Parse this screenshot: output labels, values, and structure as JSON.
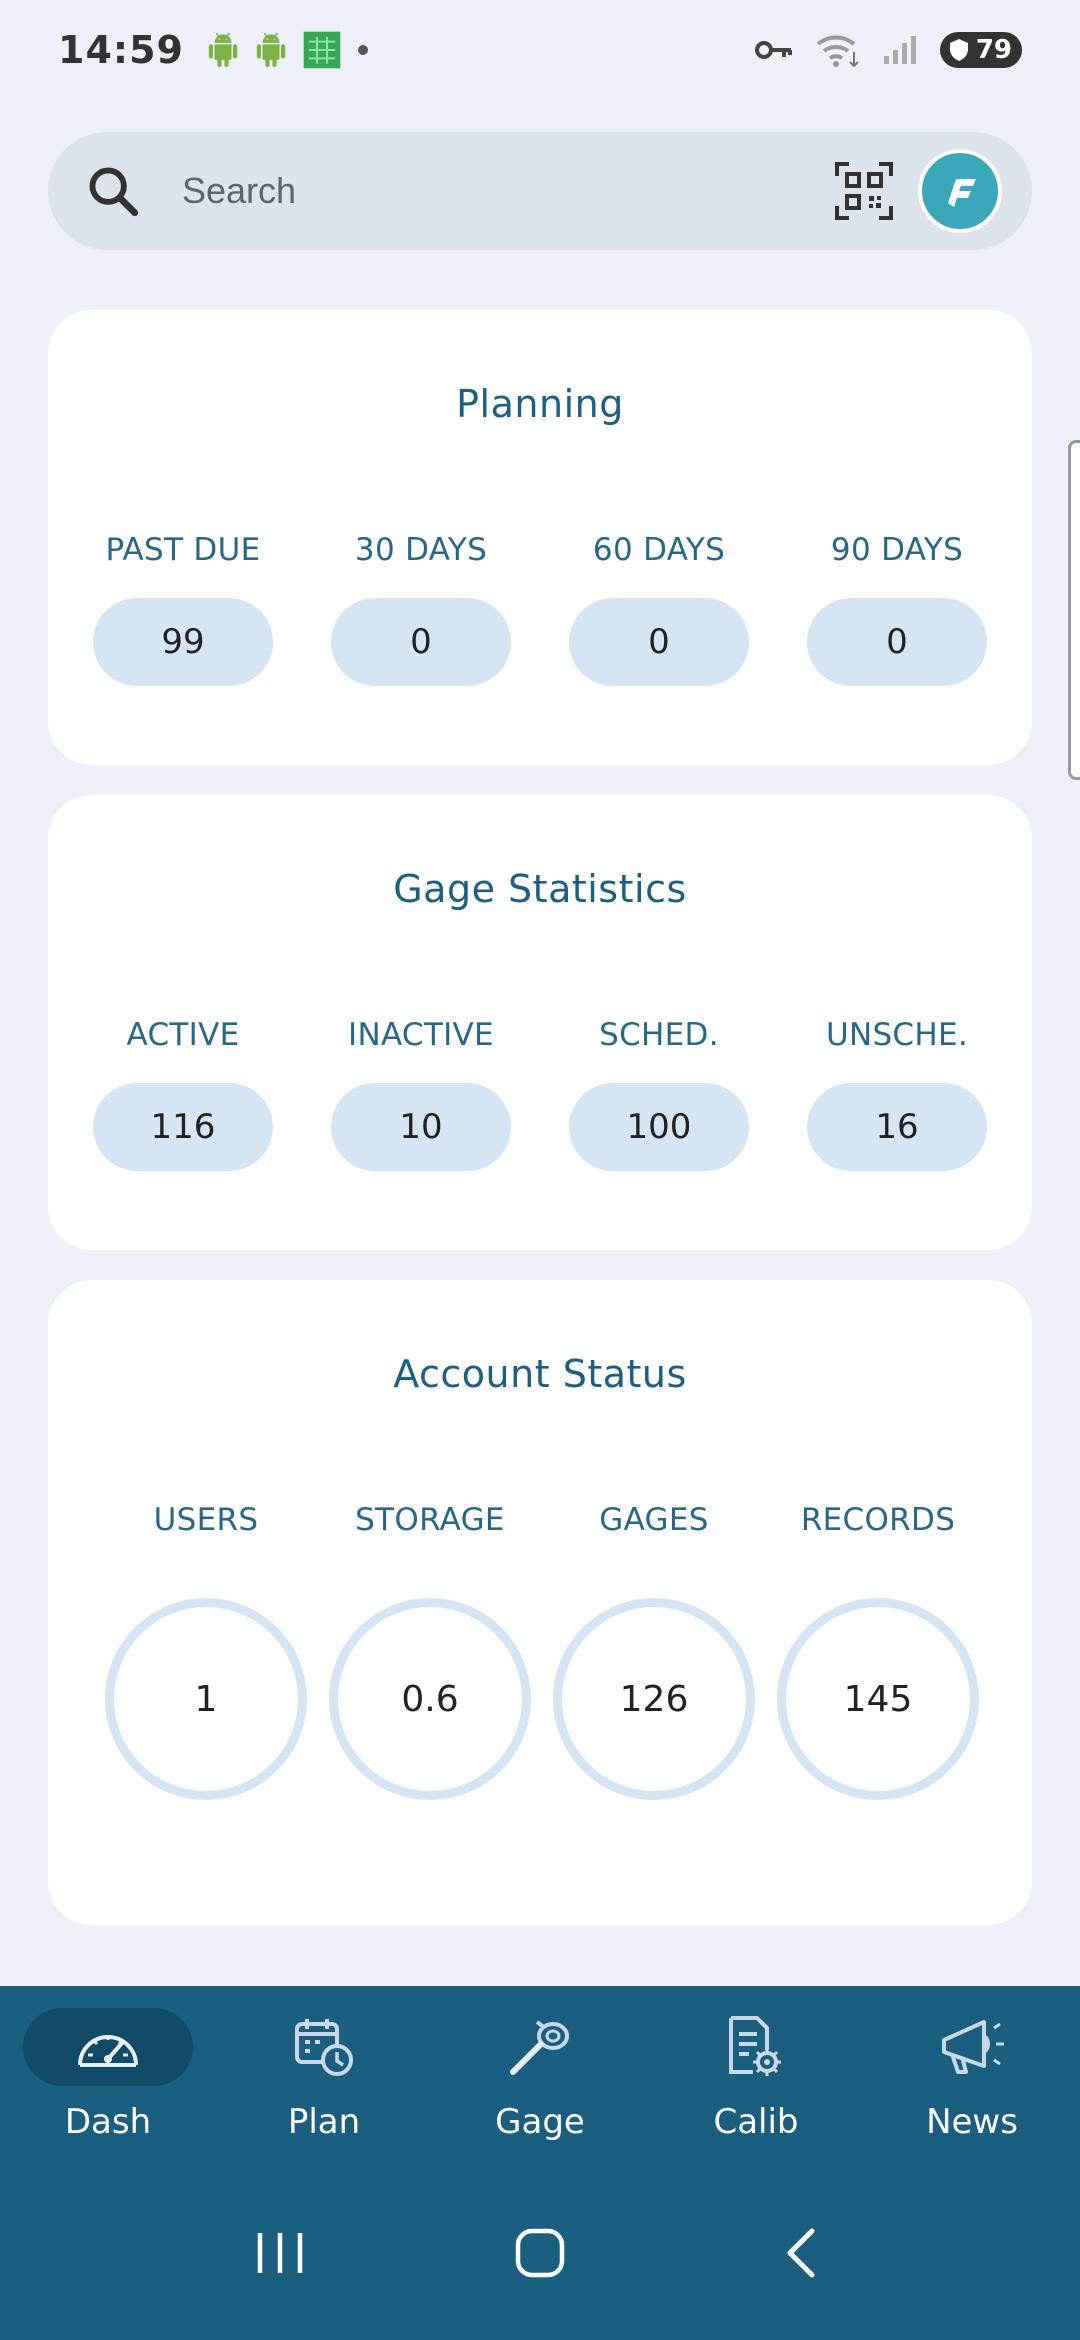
{
  "status_bar": {
    "time": "14:59",
    "battery": "79"
  },
  "search": {
    "placeholder": "Search"
  },
  "planning": {
    "title": "Planning",
    "stats": [
      {
        "label": "PAST DUE",
        "value": "99"
      },
      {
        "label": "30 DAYS",
        "value": "0"
      },
      {
        "label": "60 DAYS",
        "value": "0"
      },
      {
        "label": "90 DAYS",
        "value": "0"
      }
    ]
  },
  "gage_statistics": {
    "title": "Gage Statistics",
    "stats": [
      {
        "label": "ACTIVE",
        "value": "116"
      },
      {
        "label": "INACTIVE",
        "value": "10"
      },
      {
        "label": "SCHED.",
        "value": "100"
      },
      {
        "label": "UNSCHE.",
        "value": "16"
      }
    ]
  },
  "account_status": {
    "title": "Account Status",
    "stats": [
      {
        "label": "USERS",
        "value": "1"
      },
      {
        "label": "STORAGE",
        "value": "0.6"
      },
      {
        "label": "GAGES",
        "value": "126"
      },
      {
        "label": "RECORDS",
        "value": "145"
      }
    ]
  },
  "bottom_nav": {
    "items": [
      {
        "label": "Dash",
        "icon": "speedometer-icon",
        "active": true
      },
      {
        "label": "Plan",
        "icon": "calendar-clock-icon",
        "active": false
      },
      {
        "label": "Gage",
        "icon": "gauge-tool-icon",
        "active": false
      },
      {
        "label": "Calib",
        "icon": "document-gear-icon",
        "active": false
      },
      {
        "label": "News",
        "icon": "megaphone-icon",
        "active": false
      }
    ]
  },
  "colors": {
    "accent": "#1b5f80",
    "pill_bg": "#d6e5f4",
    "page_bg": "#edf1f7",
    "title_text": "#1e5f80"
  }
}
